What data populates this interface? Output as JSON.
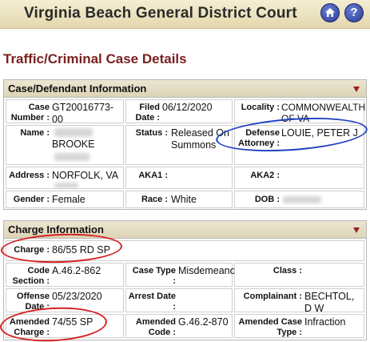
{
  "header": {
    "court_name": "Virginia Beach General District Court",
    "home_icon": "home-icon",
    "help_icon": "help-icon",
    "help_glyph": "?"
  },
  "page_title": "Traffic/Criminal Case Details",
  "case_section": {
    "title": "Case/Defendant Information",
    "case_number_label": "Case Number :",
    "case_number": "GT20016773-00",
    "filed_date_label": "Filed Date :",
    "filed_date": "06/12/2020",
    "locality_label": "Locality :",
    "locality": "COMMONWEALTH OF VA",
    "name_label": "Name :",
    "name_visible": "BROOKE",
    "status_label": "Status :",
    "status": "Released On Summons",
    "defense_attorney_label": "Defense Attorney :",
    "defense_attorney": "LOUIE, PETER J",
    "address_label": "Address :",
    "address": "NORFOLK, VA",
    "aka1_label": "AKA1 :",
    "aka2_label": "AKA2 :",
    "gender_label": "Gender :",
    "gender": "Female",
    "race_label": "Race :",
    "race": "White",
    "dob_label": "DOB :"
  },
  "charge_section": {
    "title": "Charge Information",
    "charge_label": "Charge :",
    "charge": "86/55 RD SP",
    "code_section_label": "Code Section :",
    "code_section": "A.46.2-862",
    "case_type_label": "Case Type :",
    "case_type": "Misdemeanor",
    "class_label": "Class :",
    "offense_date_label": "Offense Date :",
    "offense_date": "05/23/2020",
    "arrest_date_label": "Arrest Date :",
    "complainant_label": "Complainant :",
    "complainant": "BECHTOL, D W",
    "amended_charge_label": "Amended Charge :",
    "amended_charge": "74/55 SP",
    "amended_code_label": "Amended Code :",
    "amended_code": "G.46.2-870",
    "amended_case_type_label": "Amended Case Type :",
    "amended_case_type": "Infraction"
  },
  "colors": {
    "title_red": "#7a1f1f",
    "header_tan": "#e3d8ad",
    "annotation_blue": "#2040c0",
    "annotation_red": "#d42020"
  }
}
